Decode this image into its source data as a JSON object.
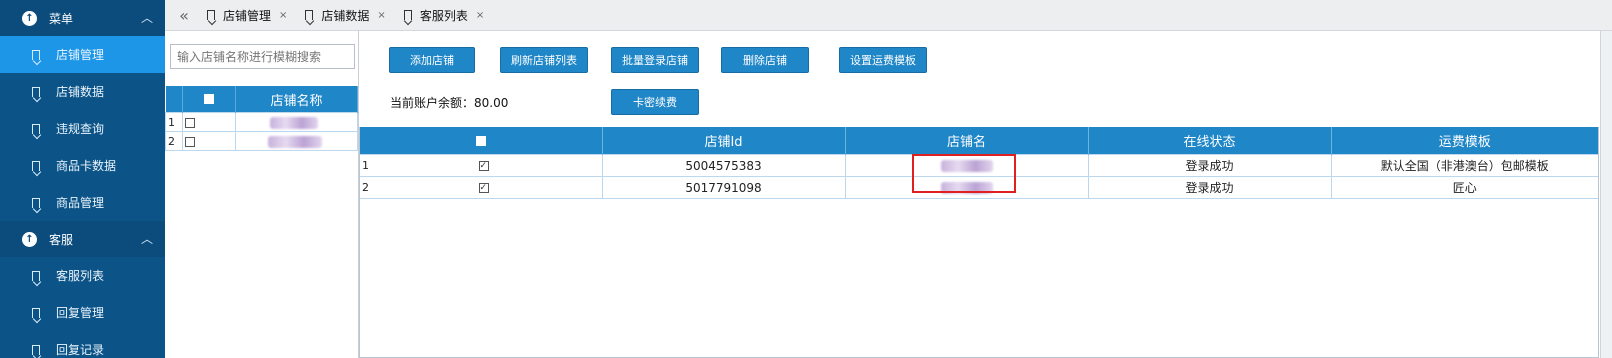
{
  "sidebar": {
    "groups": [
      {
        "label": "菜单",
        "items": [
          {
            "label": "店铺管理",
            "active": true
          },
          {
            "label": "店铺数据",
            "active": false
          },
          {
            "label": "违规查询",
            "active": false
          },
          {
            "label": "商品卡数据",
            "active": false
          },
          {
            "label": "商品管理",
            "active": false
          }
        ]
      },
      {
        "label": "客服",
        "items": [
          {
            "label": "客服列表",
            "active": false
          },
          {
            "label": "回复管理",
            "active": false
          },
          {
            "label": "回复记录",
            "active": false
          }
        ]
      }
    ]
  },
  "tabs": {
    "collapse_glyph": "«",
    "close_glyph": "×",
    "items": [
      "店铺管理",
      "店铺数据",
      "客服列表"
    ]
  },
  "search": {
    "placeholder": "输入店铺名称进行模糊搜索"
  },
  "shop_list": {
    "header": "店铺名称",
    "rows": [
      {
        "num": "1",
        "checked": false
      },
      {
        "num": "2",
        "checked": false
      }
    ]
  },
  "toolbar": {
    "add": "添加店铺",
    "refresh": "刷新店铺列表",
    "batch_login": "批量登录店铺",
    "delete": "删除店铺",
    "shipping_template": "设置运费模板",
    "card_renew": "卡密续费"
  },
  "balance": "当前账户余额：80.00",
  "shop_table": {
    "headers": [
      "店铺Id",
      "店铺名",
      "在线状态",
      "运费模板"
    ],
    "rows": [
      {
        "num": "1",
        "checked": true,
        "id": "5004575383",
        "status": "登录成功",
        "template": "默认全国（非港澳台）包邮模板"
      },
      {
        "num": "2",
        "checked": true,
        "id": "5017791098",
        "status": "登录成功",
        "template": "匠心"
      }
    ]
  },
  "colors": {
    "sidebar": "#0c5488",
    "active_item": "#1e96e8",
    "accent": "#1f86c8",
    "highlight_box": "#e02020"
  }
}
